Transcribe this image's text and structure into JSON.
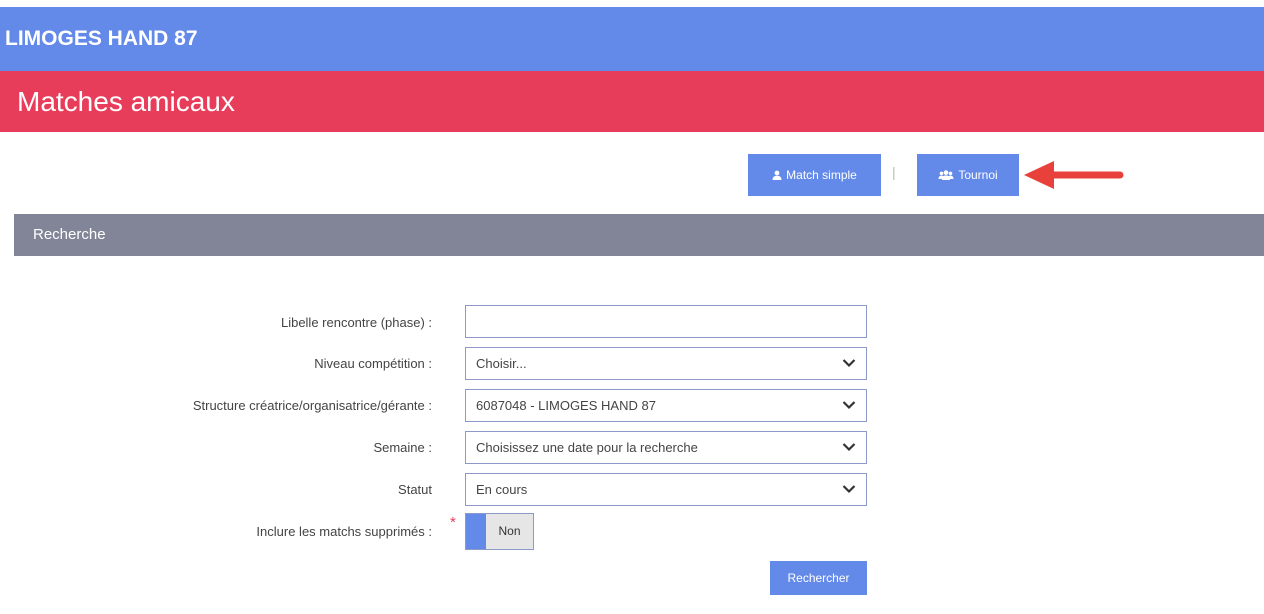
{
  "header": {
    "org_name": "LIMOGES HAND 87",
    "page_title": "Matches amicaux"
  },
  "actions": {
    "match_simple_label": "Match simple",
    "separator": "|",
    "tournoi_label": "Tournoi"
  },
  "search": {
    "section_title": "Recherche",
    "fields": {
      "libelle": {
        "label": "Libelle rencontre (phase) :",
        "value": ""
      },
      "niveau": {
        "label": "Niveau compétition :",
        "value": "Choisir..."
      },
      "structure": {
        "label": "Structure créatrice/organisatrice/gérante :",
        "value": "6087048 - LIMOGES HAND 87"
      },
      "semaine": {
        "label": "Semaine :",
        "value": "Choisissez une date pour la recherche"
      },
      "statut": {
        "label": "Statut",
        "value": "En cours"
      },
      "inclure_supprimes": {
        "label": "Inclure les matchs supprimés :",
        "required_mark": "*",
        "value": "Non"
      }
    },
    "submit_label": "Rechercher"
  },
  "colors": {
    "brand_blue": "#6389e9",
    "title_red": "#e83d5a",
    "section_gray": "#818597",
    "arrow_red": "#e8403a"
  },
  "icons": {
    "match_simple": "user-icon",
    "tournoi": "users-icon",
    "select": "chevron-down-icon",
    "annotation": "red-arrow-icon"
  }
}
